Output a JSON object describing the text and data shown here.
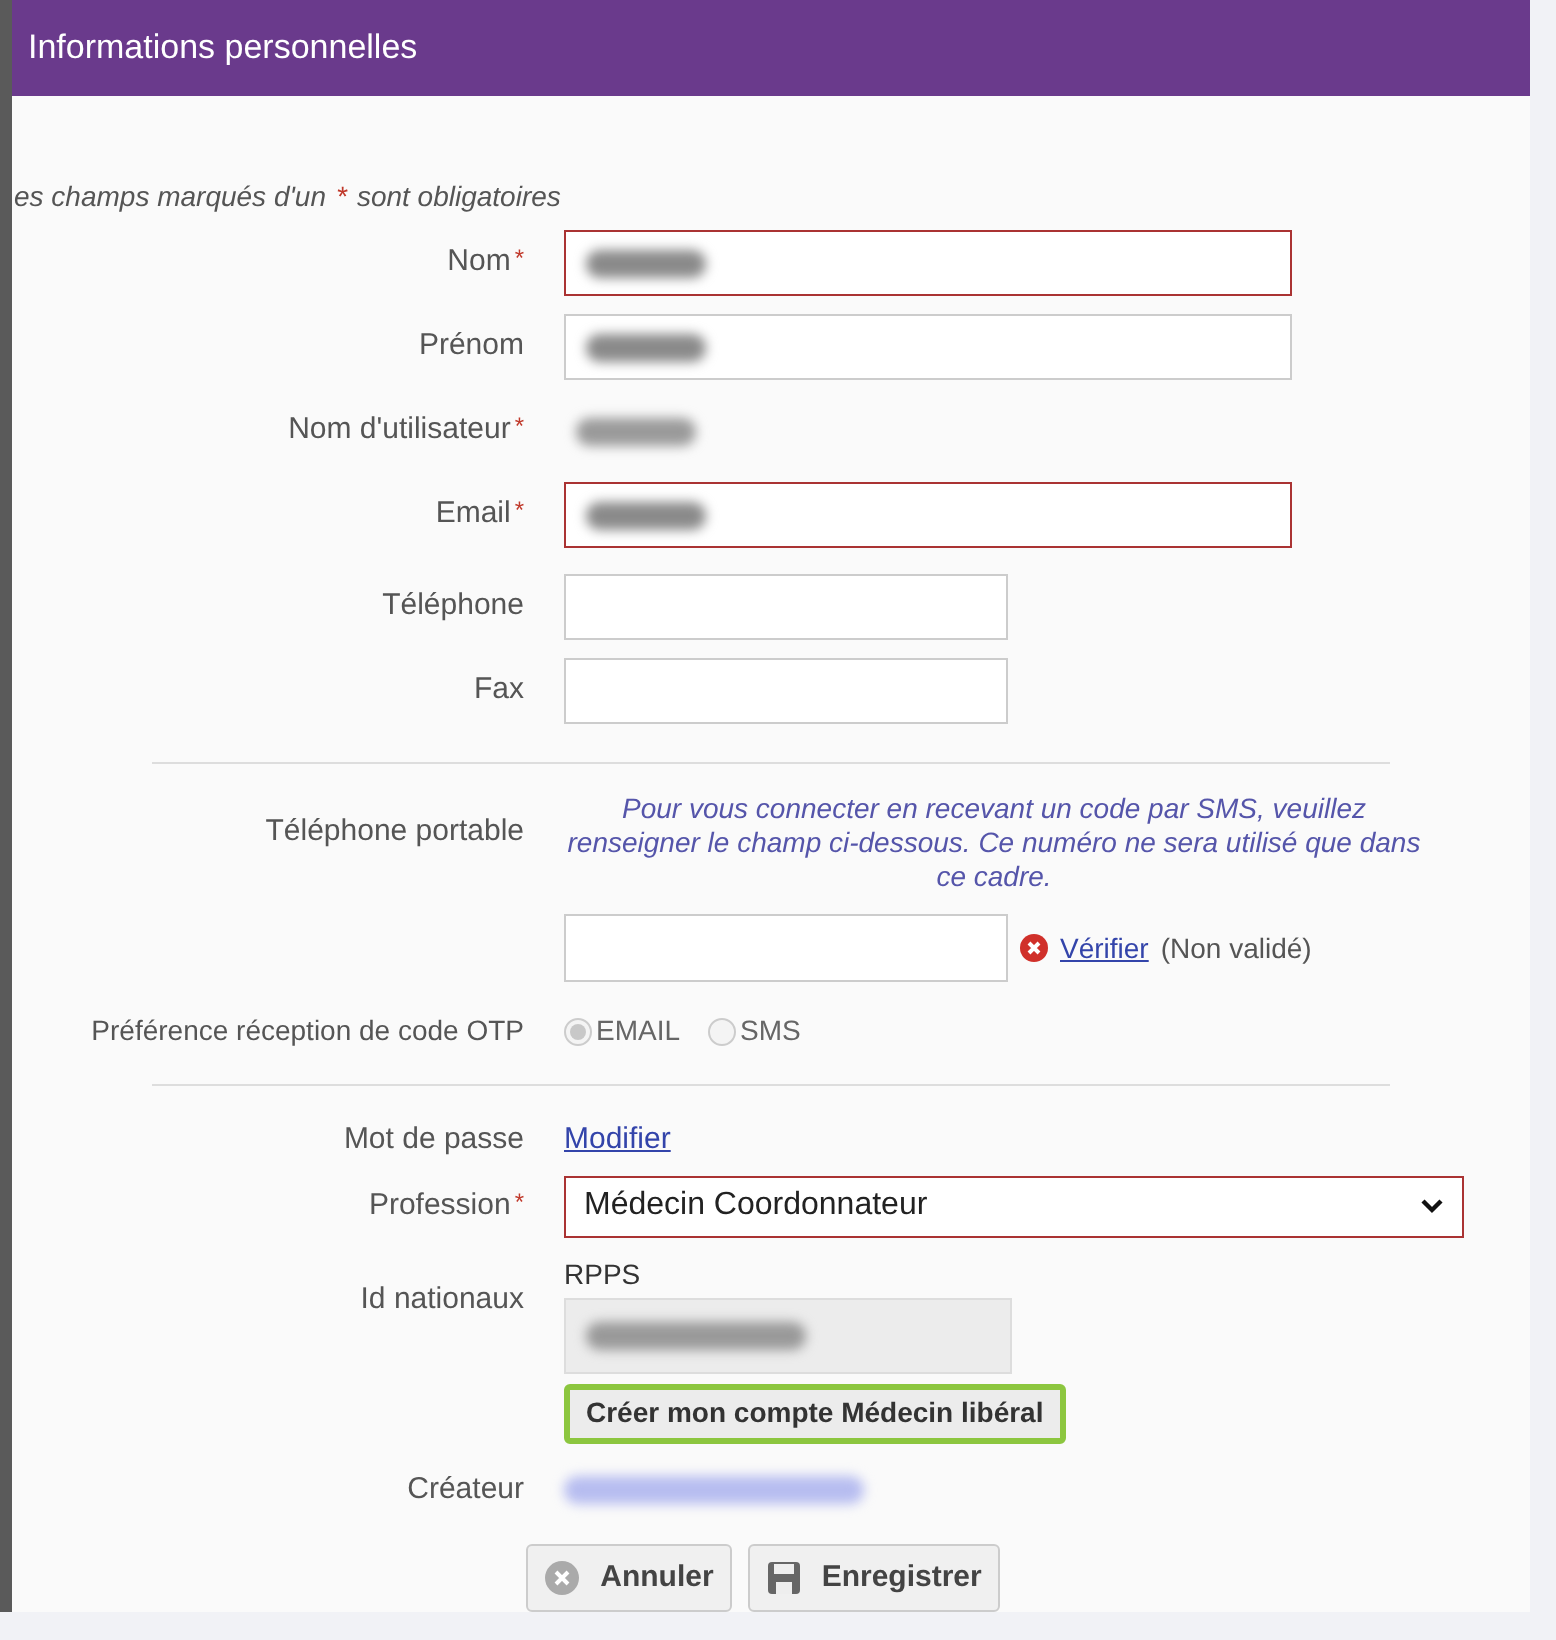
{
  "header": {
    "title": "Informations personnelles"
  },
  "required_note": {
    "before": "es champs marqués d'un",
    "star": "*",
    "after": "sont obligatoires"
  },
  "fields": [
    {
      "kind": "input",
      "label": "Nom",
      "required": true,
      "error": true,
      "blurred": true
    },
    {
      "kind": "input",
      "label": "Prénom",
      "required": false,
      "error": false,
      "blurred": true
    },
    {
      "kind": "plain",
      "label": "Nom d'utilisateur",
      "required": true,
      "blurred": true
    },
    {
      "kind": "input",
      "label": "Email",
      "required": true,
      "error": true,
      "blurred": true
    },
    {
      "kind": "short-input",
      "label": "Téléphone",
      "required": false,
      "error": false,
      "blurred": false
    },
    {
      "kind": "short-input",
      "label": "Fax",
      "required": false,
      "error": false,
      "blurred": false
    }
  ],
  "mobile": {
    "label": "Téléphone portable",
    "note": "Pour vous connecter en recevant un code par SMS, veuillez renseigner le champ ci-dessous. Ce numéro ne sera utilisé que dans ce cadre.",
    "verify_link": "Vérifier",
    "status": "(Non validé)",
    "valid": false
  },
  "otp": {
    "label": "Préférence réception de code OTP",
    "options": [
      {
        "label": "EMAIL",
        "selected": true,
        "disabled": true
      },
      {
        "label": "SMS",
        "selected": false,
        "disabled": true
      }
    ]
  },
  "password": {
    "label": "Mot de passe",
    "link": "Modifier"
  },
  "profession": {
    "label": "Profession",
    "required": true,
    "value": "Médecin Coordonnateur",
    "error": true
  },
  "ids": {
    "label": "Id nationaux",
    "sub_label": "RPPS",
    "blurred": true,
    "create_button": "Créer mon compte Médecin libéral",
    "highlighted": true
  },
  "creator": {
    "label": "Créateur",
    "blurred": true
  },
  "buttons": [
    {
      "kind": "cancel",
      "label": "Annuler"
    },
    {
      "kind": "save",
      "label": "Enregistrer"
    }
  ]
}
